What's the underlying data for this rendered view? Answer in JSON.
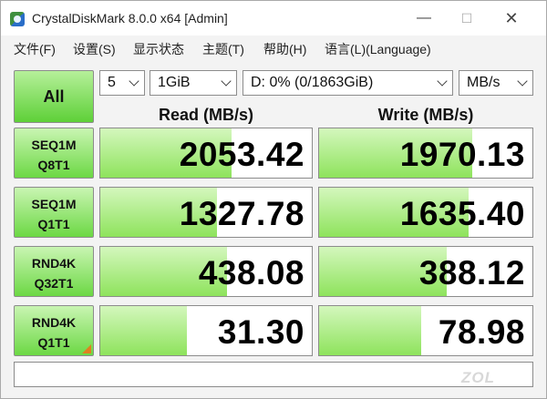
{
  "title": "CrystalDiskMark 8.0.0 x64 [Admin]",
  "window_controls": {
    "minimize": "—",
    "maximize": "☐",
    "close": "✕"
  },
  "menu": [
    "文件(F)",
    "设置(S)",
    "显示状态",
    "主题(T)",
    "帮助(H)",
    "语言(L)(Language)"
  ],
  "controls": {
    "all_label": "All",
    "count": "5",
    "size": "1GiB",
    "drive": "D: 0% (0/1863GiB)",
    "unit": "MB/s"
  },
  "headers": {
    "read": "Read (MB/s)",
    "write": "Write (MB/s)"
  },
  "tests": [
    {
      "line1": "SEQ1M",
      "line2": "Q8T1",
      "read": "2053.42",
      "write": "1970.13",
      "read_fill": 0.62,
      "write_fill": 0.72
    },
    {
      "line1": "SEQ1M",
      "line2": "Q1T1",
      "read": "1327.78",
      "write": "1635.40",
      "read_fill": 0.55,
      "write_fill": 0.7
    },
    {
      "line1": "RND4K",
      "line2": "Q32T1",
      "read": "438.08",
      "write": "388.12",
      "read_fill": 0.6,
      "write_fill": 0.6
    },
    {
      "line1": "RND4K",
      "line2": "Q1T1",
      "read": "31.30",
      "write": "78.98",
      "read_fill": 0.41,
      "write_fill": 0.48
    }
  ],
  "status": "",
  "watermark": "ZOL"
}
